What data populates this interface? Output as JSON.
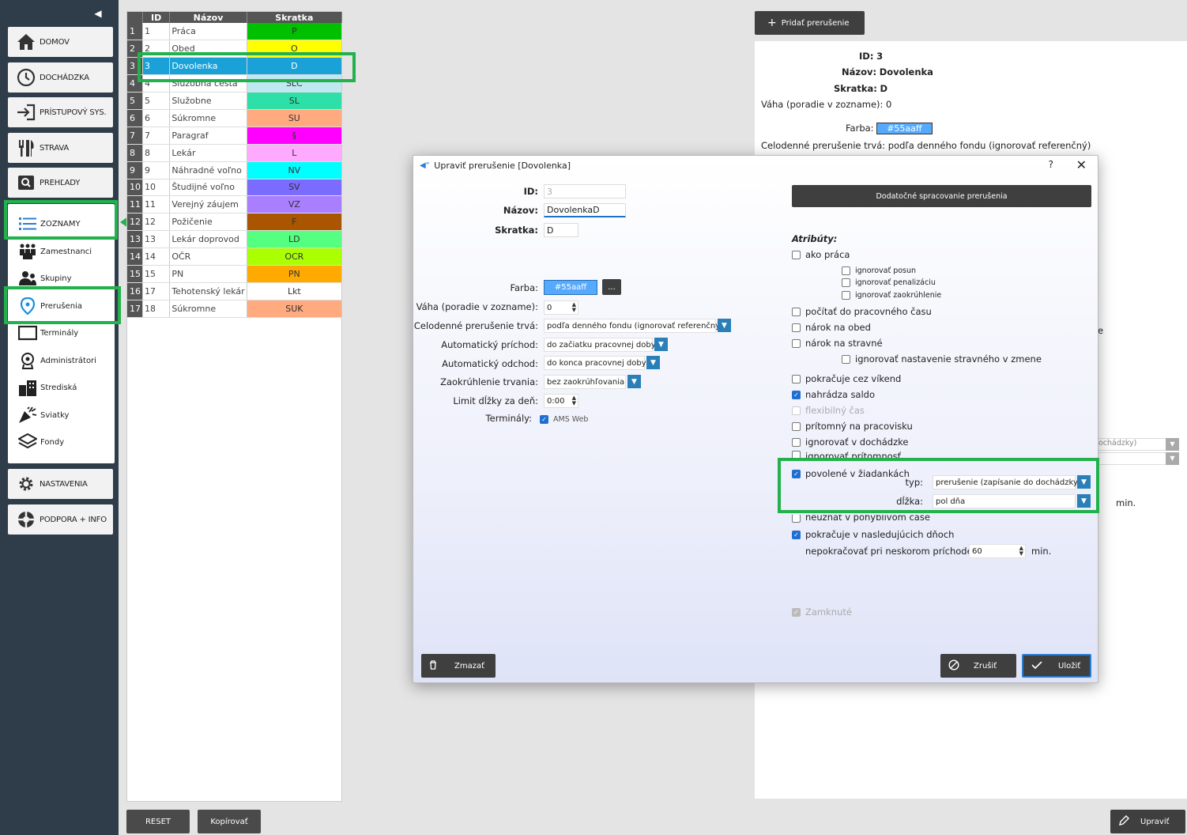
{
  "sidebar": {
    "main_items": [
      {
        "label": "DOMOV",
        "icon": "home-icon"
      },
      {
        "label": "DOCHÁDZKA",
        "icon": "clock-icon"
      },
      {
        "label": "PRÍSTUPOVÝ SYS.",
        "icon": "login-icon"
      },
      {
        "label": "STRAVA",
        "icon": "cutlery-icon"
      },
      {
        "label": "PREHĽADY",
        "icon": "search-icon"
      },
      {
        "label": "ZOZNAMY",
        "icon": "list-icon"
      }
    ],
    "sub_items": [
      {
        "label": "Zamestnanci",
        "icon": "people-icon"
      },
      {
        "label": "Skupiny",
        "icon": "group-icon"
      },
      {
        "label": "Prerušenia",
        "icon": "location-pin-icon"
      },
      {
        "label": "Terminály",
        "icon": "terminal-icon"
      },
      {
        "label": "Administrátori",
        "icon": "admin-icon"
      },
      {
        "label": "Strediská",
        "icon": "building-icon"
      },
      {
        "label": "Sviatky",
        "icon": "party-icon"
      },
      {
        "label": "Fondy",
        "icon": "layers-icon"
      }
    ],
    "bottom_items": [
      {
        "label": "NASTAVENIA",
        "icon": "gear-icon"
      },
      {
        "label": "PODPORA + INFO",
        "icon": "lifebuoy-icon"
      }
    ]
  },
  "table": {
    "headers": [
      "ID",
      "Názov",
      "Skratka"
    ],
    "rows": [
      {
        "num": "1",
        "id": "1",
        "name": "Práca",
        "abbr": "P",
        "color": "#00c000"
      },
      {
        "num": "2",
        "id": "2",
        "name": "Obed",
        "abbr": "O",
        "color": "#ffff00"
      },
      {
        "num": "3",
        "id": "3",
        "name": "Dovolenka",
        "abbr": "D",
        "color": "#55aaff"
      },
      {
        "num": "4",
        "id": "4",
        "name": "Služobná cesta",
        "abbr": "SLC",
        "color": "#c0e8f0"
      },
      {
        "num": "5",
        "id": "5",
        "name": "Služobne",
        "abbr": "SL",
        "color": "#2ee0a8"
      },
      {
        "num": "6",
        "id": "6",
        "name": "Súkromne",
        "abbr": "SU",
        "color": "#ffaa7f"
      },
      {
        "num": "7",
        "id": "7",
        "name": "Paragraf",
        "abbr": "§",
        "color": "#ff00ff"
      },
      {
        "num": "8",
        "id": "8",
        "name": "Lekár",
        "abbr": "L",
        "color": "#ffaaff"
      },
      {
        "num": "9",
        "id": "9",
        "name": "Náhradné voľno",
        "abbr": "NV",
        "color": "#00ffff"
      },
      {
        "num": "10",
        "id": "10",
        "name": "Študijné voľno",
        "abbr": "SV",
        "color": "#7b6bff"
      },
      {
        "num": "11",
        "id": "11",
        "name": "Verejný záujem",
        "abbr": "VZ",
        "color": "#aa7fff"
      },
      {
        "num": "12",
        "id": "12",
        "name": "Požičenie",
        "abbr": "F",
        "color": "#aa5500"
      },
      {
        "num": "13",
        "id": "13",
        "name": "Lekár doprovod",
        "abbr": "LD",
        "color": "#55ff7f"
      },
      {
        "num": "14",
        "id": "14",
        "name": "OČR",
        "abbr": "OCR",
        "color": "#aaff00"
      },
      {
        "num": "15",
        "id": "15",
        "name": "PN",
        "abbr": "PN",
        "color": "#ffaa00"
      },
      {
        "num": "16",
        "id": "17",
        "name": "Tehotenský lekár",
        "abbr": "Lkt",
        "color": "#ffffff"
      },
      {
        "num": "17",
        "id": "18",
        "name": "Súkromne",
        "abbr": "SUK",
        "color": "#ffaa7f"
      }
    ],
    "selected_row": 2
  },
  "buttons": {
    "reset": "RESET",
    "copy": "Kopírovať",
    "add": "Pridať prerušenie",
    "edit": "Upraviť"
  },
  "detail": {
    "id_label": "ID:",
    "id_value": "3",
    "name_label": "Názov:",
    "name_value": "Dovolenka",
    "abbr_label": "Skratka:",
    "abbr_value": "D",
    "weight_label": "Váha (poradie v zozname):",
    "weight_value": "0",
    "color_label": "Farba:",
    "color_value": "#55aaff",
    "fullday_label": "Celodenné prerušenie trvá:",
    "fullday_value": "podľa denného fondu (ignorovať referenčný)",
    "partial_e": "e",
    "partial_dochadzky": "ochádzky)",
    "partial_min": "min."
  },
  "dialog": {
    "title": "Upraviť prerušenie [Dovolenka]",
    "help": "?",
    "close": "✕",
    "id_label": "ID:",
    "id_value": "3",
    "name_label": "Názov:",
    "name_value": "DovolenkaD",
    "abbr_label": "Skratka:",
    "abbr_value": "D",
    "color_label": "Farba:",
    "color_value": "#55aaff",
    "color_btn": "...",
    "weight_label": "Váha (poradie v zozname):",
    "weight_value": "0",
    "fullday_label": "Celodenné prerušenie trvá:",
    "fullday_value": "podľa denného fondu (ignorovať referenčný)",
    "auto_in_label": "Automatický príchod:",
    "auto_in_value": "do začiatku pracovnej doby",
    "auto_out_label": "Automatický odchod:",
    "auto_out_value": "do konca pracovnej doby",
    "rounding_label": "Zaokrúhlenie trvania:",
    "rounding_value": "bez zaokrúhľovania",
    "limit_label": "Limit dĺžky za deň:",
    "limit_value": "0:00",
    "terminals_label": "Terminály:",
    "terminals_value": "AMS Web",
    "extra_btn": "Dodatočné spracovanie prerušenia",
    "attributes_title": "Atribúty:",
    "attrs": {
      "ako_praca": "ako práca",
      "ign_posun": "ignorovať posun",
      "ign_penal": "ignorovať penalizáciu",
      "ign_zaokr": "ignorovať zaokrúhlenie",
      "pocitat": "počítať do pracovného času",
      "obed": "nárok na obed",
      "stravne": "nárok na stravné",
      "ign_strav": "ignorovať nastavenie stravného v zmene",
      "vikend": "pokračuje cez víkend",
      "saldo": "nahrádza saldo",
      "flex": "flexibilný čas",
      "pritomny": "prítomný na pracovisku",
      "ign_doch": "ignorovať v dochádzke",
      "ign_prit": "ignorovať prítomnosť",
      "ziadanky": "povolené v žiadankách",
      "typ_label": "typ:",
      "typ_value": "prerušenie (zapísanie do dochádzky)",
      "dlzka_label": "dĺžka:",
      "dlzka_value": "pol dňa",
      "neuznat": "neuznať v pohyblivom čase",
      "nasl_dni": "pokračuje v nasledujúcich dňoch",
      "nepokr_label": "nepokračovať pri neskorom príchode do:",
      "nepokr_value": "60",
      "nepokr_unit": "min.",
      "zamknute": "Zamknuté"
    },
    "delete_btn": "Zmazať",
    "cancel_btn": "Zrušiť",
    "save_btn": "Uložiť"
  }
}
